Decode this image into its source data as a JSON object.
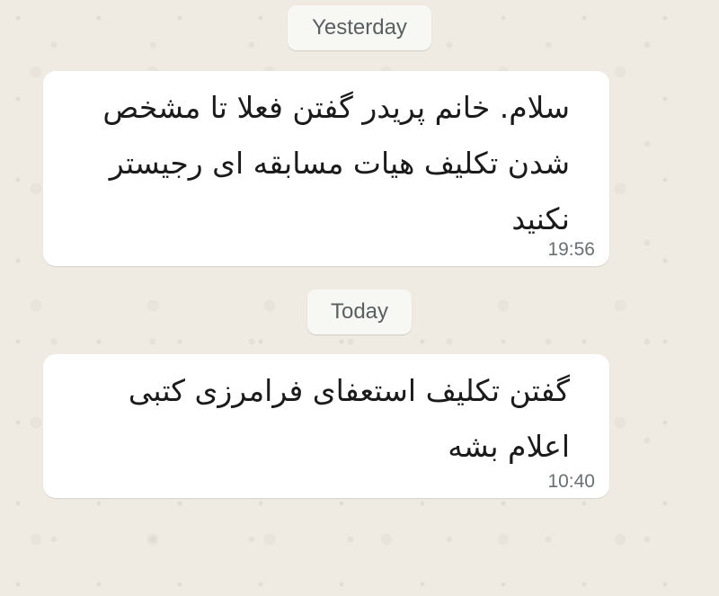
{
  "chat": {
    "date_yesterday": "Yesterday",
    "date_today": "Today",
    "messages": [
      {
        "lines": [
          "سلام. خانم پریدر گفتن فعلا تا مشخص",
          "شدن تکلیف هیات مسابقه ای رجیستر",
          "نکنید"
        ],
        "time": "19:56"
      },
      {
        "lines": [
          "گفتن تکلیف استعفای فرامرزی کتبی",
          "اعلام بشه"
        ],
        "time": "10:40"
      }
    ]
  }
}
